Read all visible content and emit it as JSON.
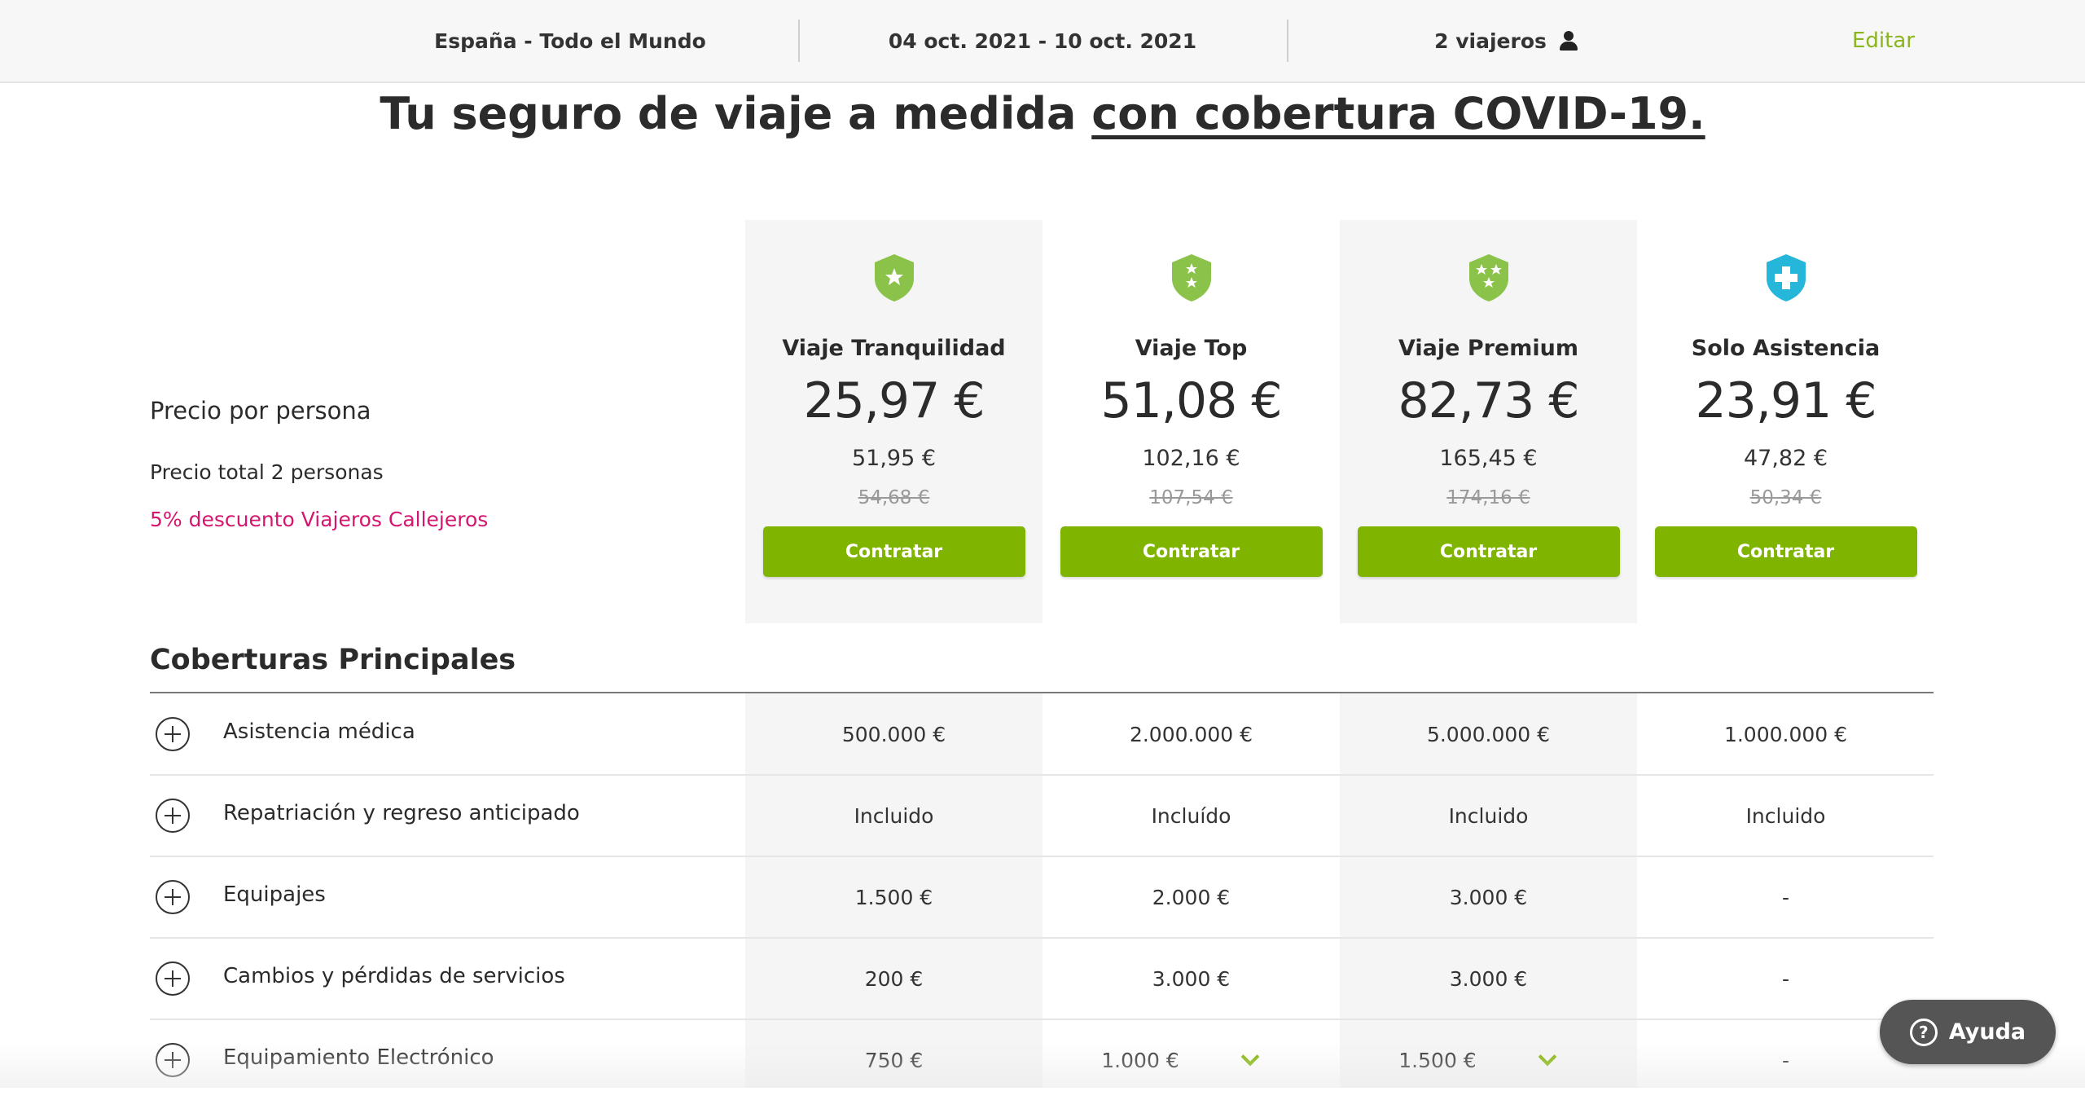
{
  "topbar": {
    "destination": "España - Todo el Mundo",
    "dates": "04 oct. 2021 - 10 oct. 2021",
    "travelers": "2 viajeros",
    "edit": "Editar"
  },
  "headline": {
    "text": "Tu seguro de viaje a medida ",
    "link": "con cobertura COVID-19."
  },
  "labels": {
    "price_per_person": "Precio por persona",
    "total_price": "Precio total 2 personas",
    "discount": "5% descuento Viajeros Callejeros"
  },
  "plans": [
    {
      "name": "Viaje Tranquilidad",
      "price": "25,97 €",
      "total": "51,95 €",
      "old": "54,68 €",
      "button": "Contratar",
      "icon": "shield-one-star-icon",
      "color": "#8bc34a"
    },
    {
      "name": "Viaje Top",
      "price": "51,08 €",
      "total": "102,16 €",
      "old": "107,54 €",
      "button": "Contratar",
      "icon": "shield-two-stars-icon",
      "color": "#8bc34a"
    },
    {
      "name": "Viaje Premium",
      "price": "82,73 €",
      "total": "165,45 €",
      "old": "174,16 €",
      "button": "Contratar",
      "icon": "shield-three-stars-icon",
      "color": "#8bc34a"
    },
    {
      "name": "Solo Asistencia",
      "price": "23,91 €",
      "total": "47,82 €",
      "old": "50,34 €",
      "button": "Contratar",
      "icon": "shield-cross-icon",
      "color": "#26b6d9"
    }
  ],
  "coverage": {
    "title": "Coberturas Principales",
    "rows": [
      {
        "label": "Asistencia médica",
        "values": [
          "500.000 €",
          "2.000.000 €",
          "5.000.000 €",
          "1.000.000 €"
        ]
      },
      {
        "label": "Repatriación y regreso anticipado",
        "values": [
          "Incluido",
          "Incluído",
          "Incluido",
          "Incluido"
        ]
      },
      {
        "label": "Equipajes",
        "values": [
          "1.500 €",
          "2.000 €",
          "3.000 €",
          "-"
        ]
      },
      {
        "label": "Cambios y pérdidas de servicios",
        "values": [
          "200 €",
          "3.000 €",
          "3.000 €",
          "-"
        ]
      },
      {
        "label": "Equipamiento Electrónico",
        "values": [
          "750 €",
          "1.000 €",
          "1.500 €",
          "-"
        ]
      }
    ]
  },
  "help": {
    "label": "Ayuda"
  }
}
